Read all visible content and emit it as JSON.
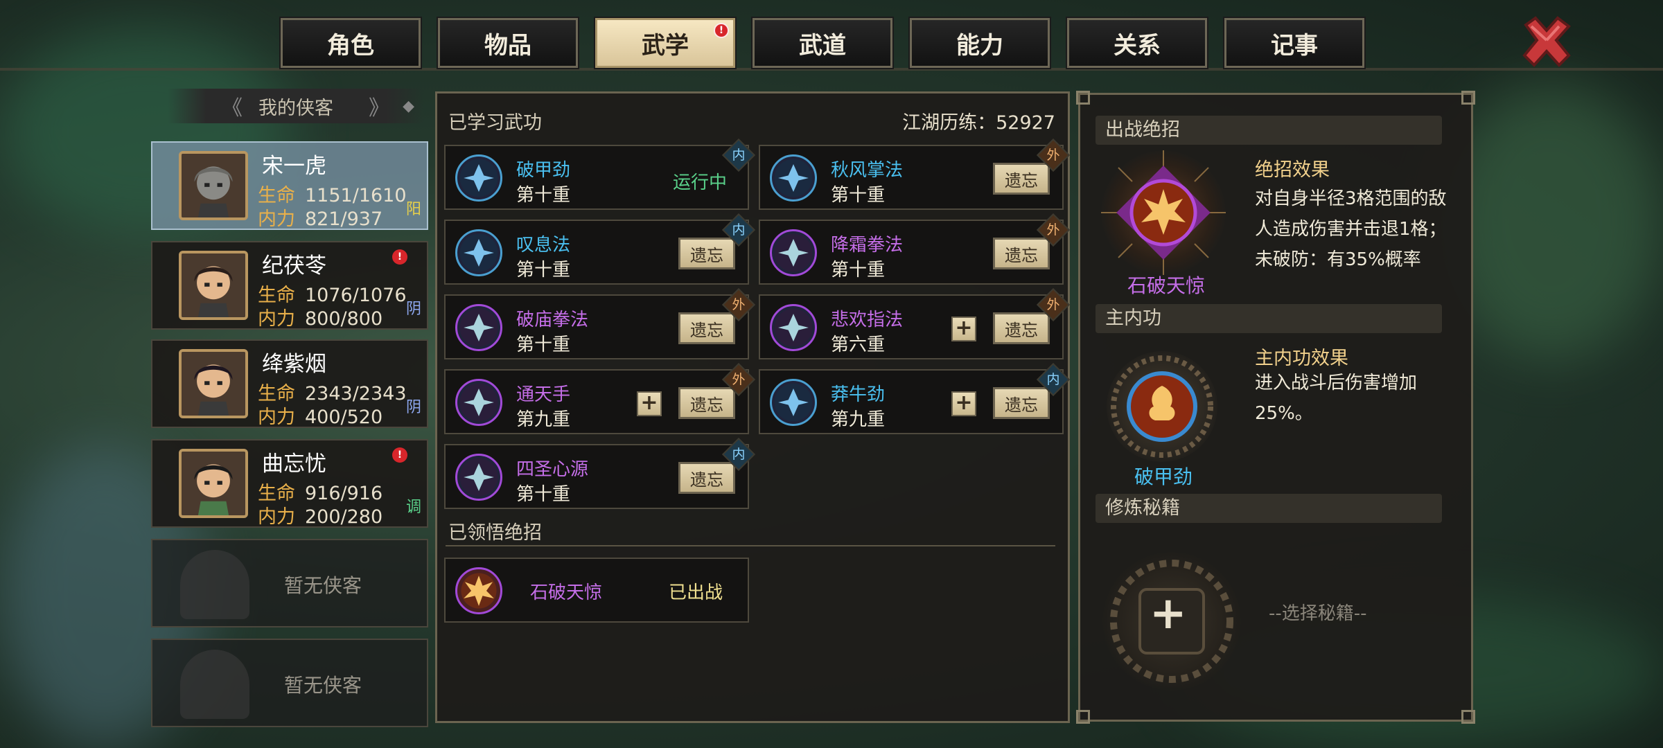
{
  "tabs": [
    {
      "label": "角色",
      "active": false
    },
    {
      "label": "物品",
      "active": false
    },
    {
      "label": "武学",
      "active": true,
      "alert": "!"
    },
    {
      "label": "武道",
      "active": false
    },
    {
      "label": "能力",
      "active": false
    },
    {
      "label": "关系",
      "active": false
    },
    {
      "label": "记事",
      "active": false
    }
  ],
  "roster": {
    "title": "我的侠客",
    "heroes": [
      {
        "name": "宋一虎",
        "hp_k": "生命",
        "hp": "1151/1610",
        "mp_k": "内力",
        "mp": "821/937",
        "tag": "阳",
        "tag_color": "#e8d04a",
        "selected": true
      },
      {
        "name": "纪茯苓",
        "hp_k": "生命",
        "hp": "1076/1076",
        "mp_k": "内力",
        "mp": "800/800",
        "tag": "阴",
        "tag_color": "#8ea8f0",
        "alert": "!"
      },
      {
        "name": "绛紫烟",
        "hp_k": "生命",
        "hp": "2343/2343",
        "mp_k": "内力",
        "mp": "400/520",
        "tag": "阴",
        "tag_color": "#8ea8f0"
      },
      {
        "name": "曲忘忧",
        "hp_k": "生命",
        "hp": "916/916",
        "mp_k": "内力",
        "mp": "200/280",
        "tag": "调",
        "tag_color": "#5ad18a",
        "alert": "!"
      }
    ],
    "empty_label": "暂无侠客"
  },
  "learned": {
    "title": "已学习武功",
    "experience": "江湖历练：52927",
    "skills": [
      {
        "name": "破甲劲",
        "level": "第十重",
        "type": "内",
        "color": "#4ac0f0",
        "status": "运行中"
      },
      {
        "name": "秋风掌法",
        "level": "第十重",
        "type": "外",
        "color": "#4ac0f0",
        "action": "遗忘"
      },
      {
        "name": "叹息法",
        "level": "第十重",
        "type": "内",
        "color": "#4ac0f0",
        "action": "遗忘"
      },
      {
        "name": "降霜拳法",
        "level": "第十重",
        "type": "外",
        "color": "#c56ee8",
        "action": "遗忘"
      },
      {
        "name": "破庙拳法",
        "level": "第十重",
        "type": "外",
        "color": "#c56ee8",
        "action": "遗忘"
      },
      {
        "name": "悲欢指法",
        "level": "第六重",
        "type": "外",
        "color": "#c56ee8",
        "action": "遗忘",
        "plus": "+"
      },
      {
        "name": "通天手",
        "level": "第九重",
        "type": "外",
        "color": "#c56ee8",
        "action": "遗忘",
        "plus": "+"
      },
      {
        "name": "莽牛劲",
        "level": "第九重",
        "type": "内",
        "color": "#4ac0f0",
        "action": "遗忘",
        "plus": "+"
      },
      {
        "name": "四圣心源",
        "level": "第十重",
        "type": "内",
        "color": "#c56ee8",
        "action": "遗忘"
      }
    ]
  },
  "ultimate_list": {
    "title": "已领悟绝招",
    "item": {
      "name": "石破天惊",
      "status": "已出战"
    }
  },
  "right": {
    "ult_section": "出战绝招",
    "ult_effect_title": "绝招效果",
    "ult_effect_desc": "对自身半径3格范围的敌人造成伤害并击退1格；未破防：有35%概率",
    "ult_name": "石破天惊",
    "inner_section": "主内功",
    "inner_effect_title": "主内功效果",
    "inner_effect_desc": "进入战斗后伤害增加25%。",
    "inner_name": "破甲劲",
    "manual_section": "修炼秘籍",
    "manual_plus": "+",
    "manual_placeholder": "--选择秘籍--"
  }
}
